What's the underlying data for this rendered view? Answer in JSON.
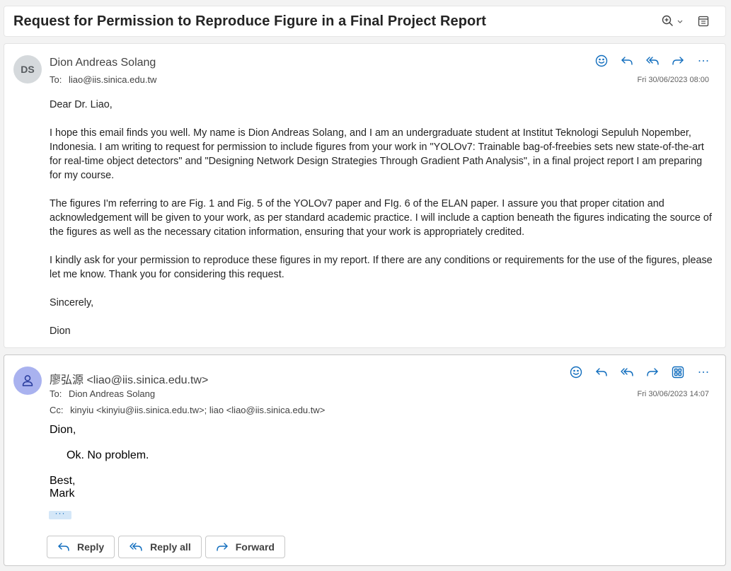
{
  "subject": "Request for Permission to Reproduce Figure in a Final Project Report",
  "toolbar": {
    "zoom_icon": "zoom-in-icon",
    "chevron_icon": "chevron-down-icon",
    "popout_icon": "popout-icon"
  },
  "message1": {
    "avatar_initials": "DS",
    "sender": "Dion Andreas Solang",
    "to_label": "To:",
    "to": "liao@iis.sinica.edu.tw",
    "date": "Fri 30/06/2023 08:00",
    "actions": [
      "emoji-icon",
      "reply-icon",
      "reply-all-icon",
      "forward-icon",
      "more-icon"
    ],
    "body": [
      "Dear Dr. Liao,",
      "I hope this email finds you well. My name is Dion Andreas Solang, and I am an undergraduate student at Institut Teknologi Sepuluh Nopember, Indonesia. I am writing to request for permission to include figures from your work in \"YOLOv7: Trainable bag-of-freebies sets new state-of-the-art for real-time object detectors\" and \"Designing Network Design Strategies Through Gradient Path Analysis\", in a final project report I am preparing for my course.",
      "The figures I'm referring to are Fig. 1 and Fig. 5 of the YOLOv7 paper and FIg. 6 of the ELAN paper. I assure you that proper citation and acknowledgement will be given to your work, as per standard academic practice. I will include a caption beneath the figures indicating the source of the figures as well as the necessary citation information, ensuring that your work is appropriately credited.",
      "I kindly ask for your permission to reproduce these figures in my report. If there are any conditions or requirements for the use of the figures, please let me know. Thank you for considering this request.",
      "Sincerely,",
      "Dion"
    ]
  },
  "message2": {
    "sender": "廖弘源 <liao@iis.sinica.edu.tw>",
    "to_label": "To:",
    "to": "Dion Andreas Solang",
    "cc_label": "Cc:",
    "cc": "kinyiu <kinyiu@iis.sinica.edu.tw>;  liao <liao@iis.sinica.edu.tw>",
    "date": "Fri 30/06/2023 14:07",
    "actions": [
      "emoji-icon",
      "reply-icon",
      "reply-all-icon",
      "forward-icon",
      "apps-icon",
      "more-icon"
    ],
    "body_greeting": "Dion,",
    "body_main": "Ok.  No problem.",
    "body_sign1": "Best,",
    "body_sign2": "Mark",
    "ellipsis": "···",
    "reply_buttons": {
      "reply": "Reply",
      "reply_all": "Reply all",
      "forward": "Forward"
    }
  },
  "colors": {
    "accent": "#0f6cbd",
    "background": "#f3f3f3",
    "card": "#ffffff"
  }
}
